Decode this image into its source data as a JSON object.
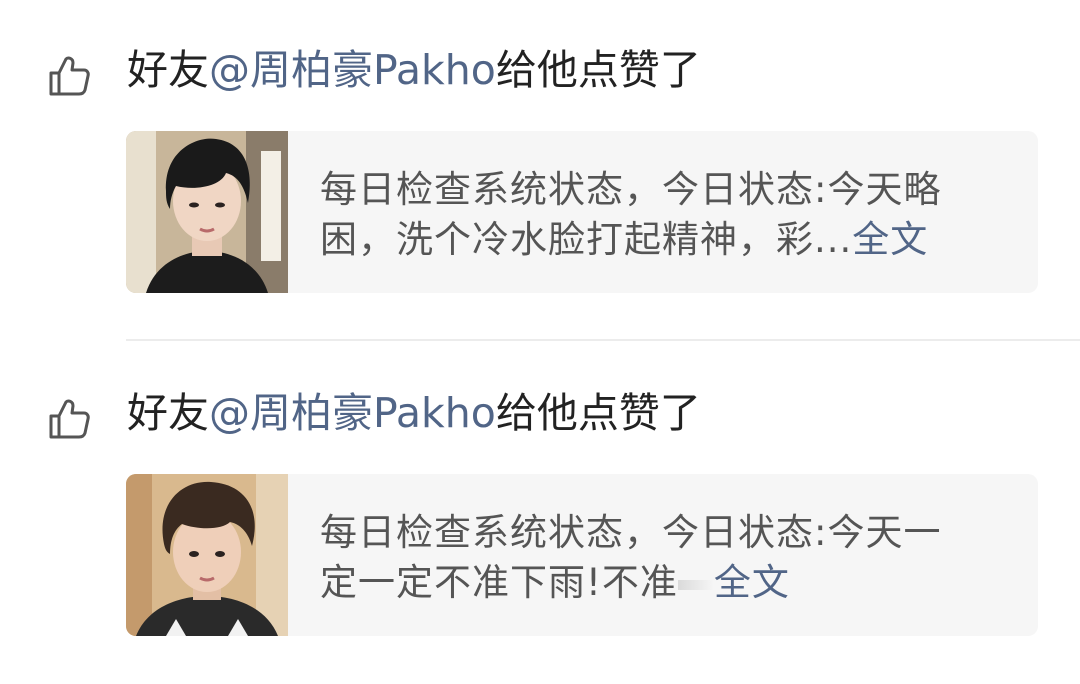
{
  "feed": [
    {
      "like_prefix": "好友",
      "mention": "@周柏豪Pakho",
      "like_suffix": "给他点赞了",
      "like_icon": "thumbs-up-icon",
      "post_line1": "每日检查系统状态，今日状态:今天略",
      "post_line2": "困，洗个冷水脸打起精神，彩...",
      "more_label": "全文"
    },
    {
      "like_prefix": "好友",
      "mention": "@周柏豪Pakho",
      "like_suffix": "给他点赞了",
      "like_icon": "thumbs-up-icon",
      "post_line1": "每日检查系统状态，今日状态:今天一",
      "post_line2": "定一定不准下雨!不准",
      "more_label": "全文"
    }
  ],
  "colors": {
    "mention": "#516587",
    "card_background": "#f6f6f6",
    "body_text": "#555555"
  }
}
